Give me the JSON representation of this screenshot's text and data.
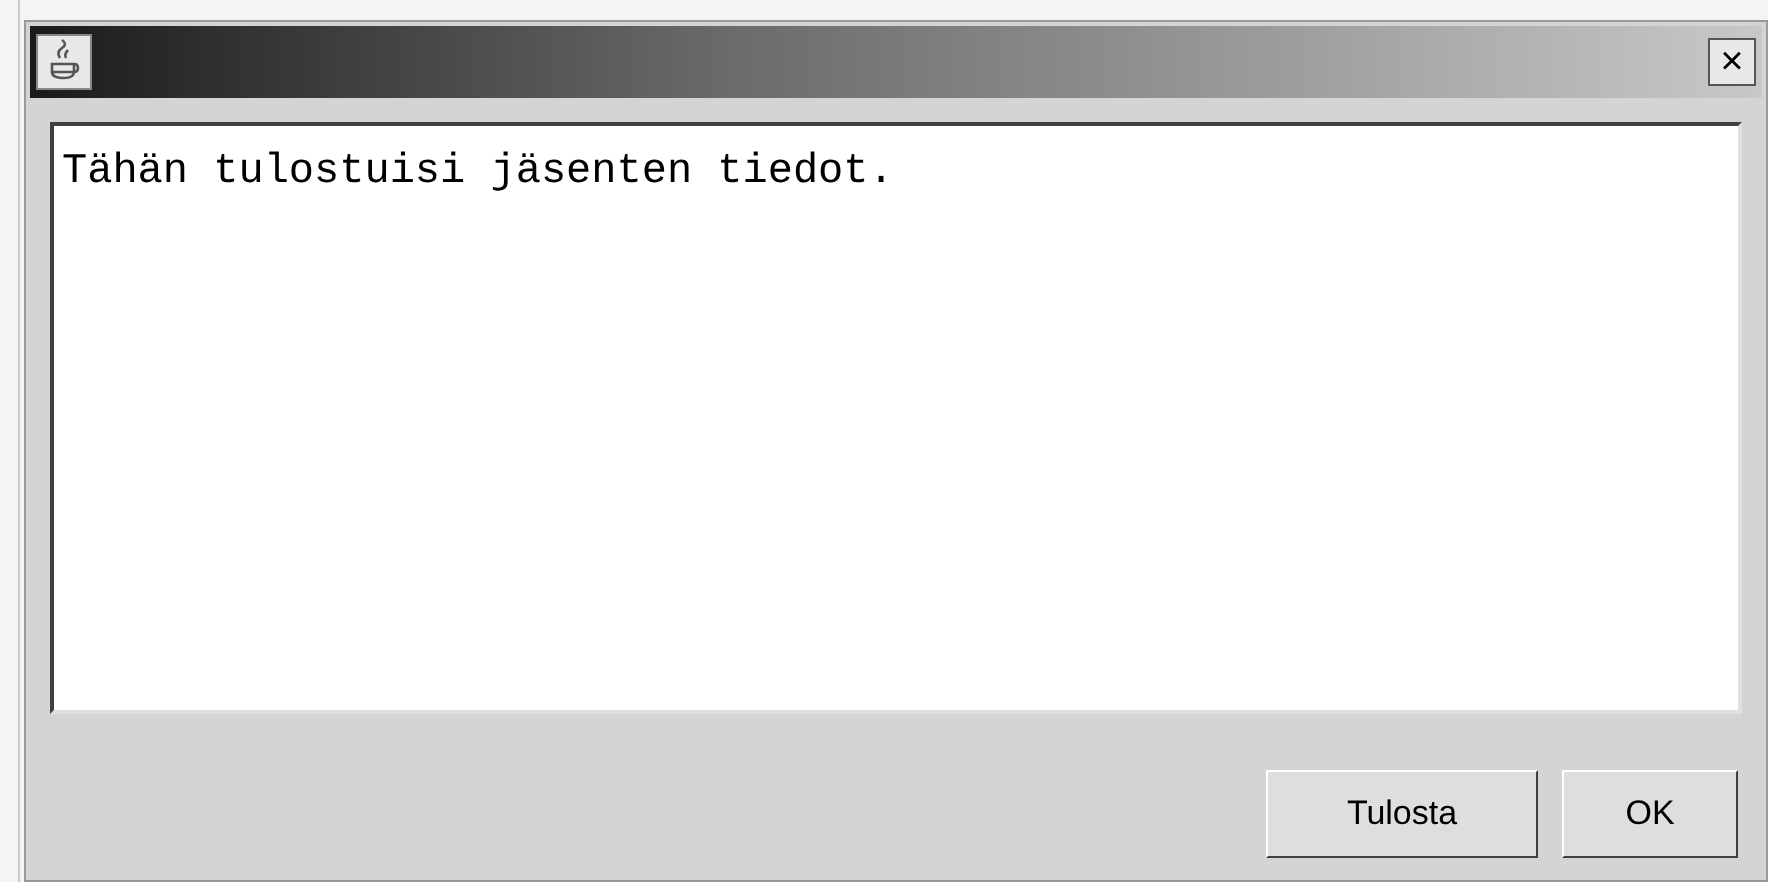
{
  "window": {
    "close_label": "×"
  },
  "text_area": {
    "value": "Tähän tulostuisi jäsenten tiedot."
  },
  "buttons": [
    "Tulosta",
    "OK"
  ]
}
